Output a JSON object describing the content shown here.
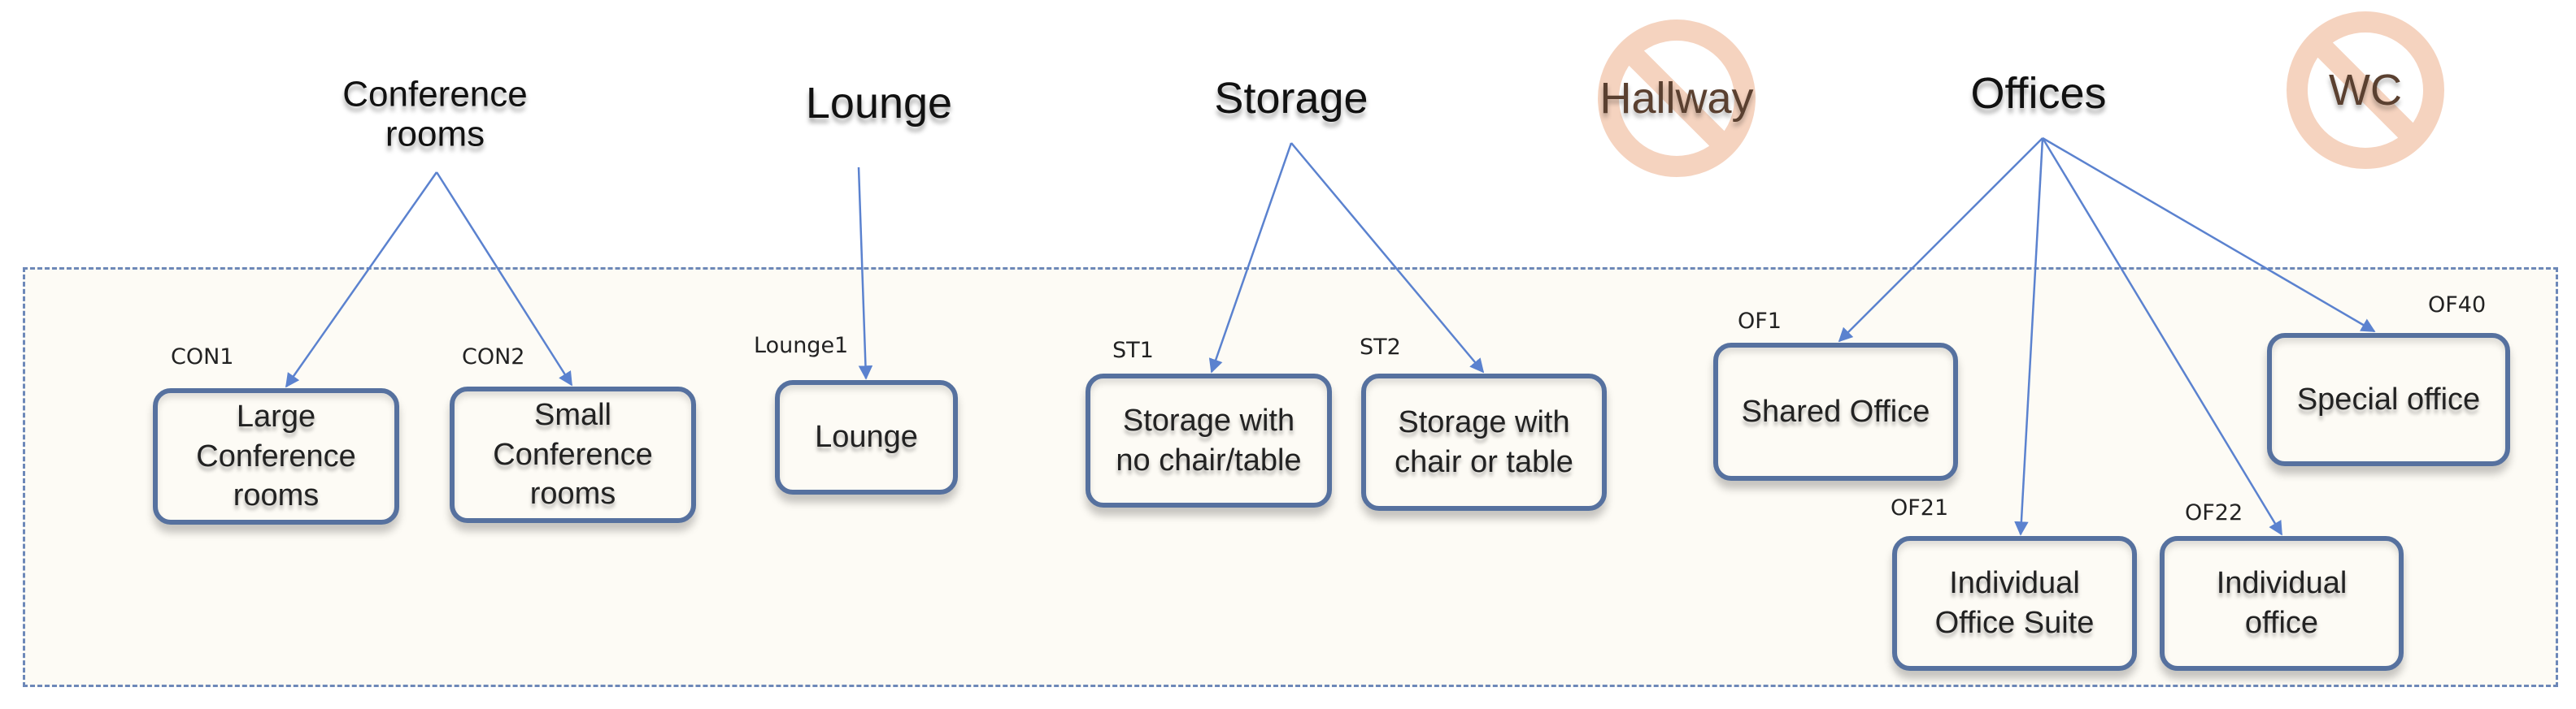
{
  "colors": {
    "edge": "#5b82cf",
    "node_border": "#56719f",
    "region_border": "#6d88b8",
    "region_fill": "#fdfbf5",
    "excluded_symbol": "#f5d3bf"
  },
  "categories": [
    {
      "id": "conference",
      "label": "Conference\nrooms"
    },
    {
      "id": "lounge",
      "label": "Lounge"
    },
    {
      "id": "storage",
      "label": "Storage"
    },
    {
      "id": "hallway",
      "label": "Hallway",
      "excluded": true,
      "icon": "no-entry-icon"
    },
    {
      "id": "offices",
      "label": "Offices"
    },
    {
      "id": "wc",
      "label": "WC",
      "excluded": true,
      "icon": "no-entry-icon"
    }
  ],
  "nodes": [
    {
      "code": "CON1",
      "label": "Large\nConference\nrooms",
      "parent": "conference"
    },
    {
      "code": "CON2",
      "label": "Small\nConference\nrooms",
      "parent": "conference"
    },
    {
      "code": "Lounge1",
      "label": "Lounge",
      "parent": "lounge"
    },
    {
      "code": "ST1",
      "label": "Storage with\nno chair/table",
      "parent": "storage"
    },
    {
      "code": "ST2",
      "label": "Storage with\nchair or table",
      "parent": "storage"
    },
    {
      "code": "OF1",
      "label": "Shared Office",
      "parent": "offices"
    },
    {
      "code": "OF21",
      "label": "Individual\nOffice Suite",
      "parent": "offices"
    },
    {
      "code": "OF22",
      "label": "Individual\noffice",
      "parent": "offices"
    },
    {
      "code": "OF40",
      "label": "Special office",
      "parent": "offices"
    }
  ]
}
